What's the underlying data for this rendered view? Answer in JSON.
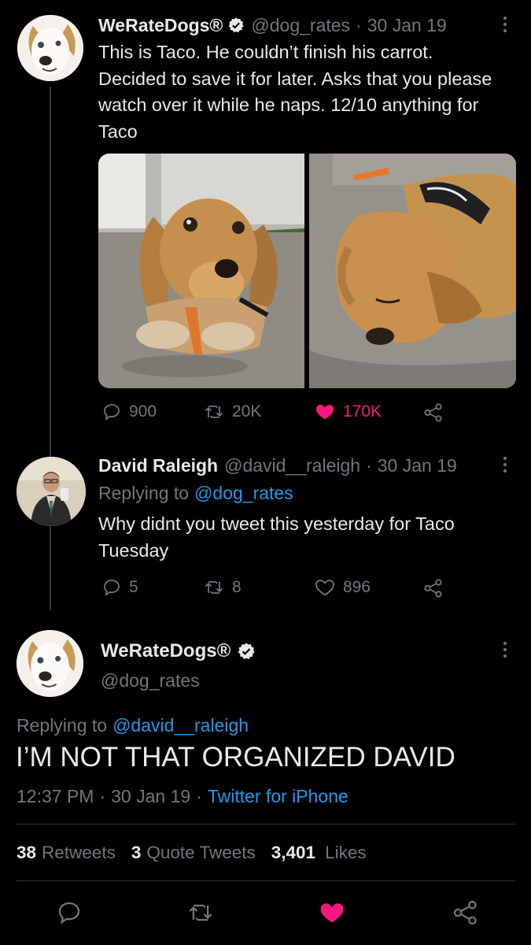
{
  "tweet1": {
    "name": "WeRateDogs®",
    "handle": "@dog_rates",
    "sep": "·",
    "date": "30 Jan 19",
    "text": "This is Taco. He couldn’t finish his carrot. Decided to save it for later. Asks that you please watch over it while he naps. 12/10 anything for Taco",
    "replies": "900",
    "retweets": "20K",
    "likes": "170K",
    "liked_color": "#f91880"
  },
  "tweet2": {
    "name": "David Raleigh",
    "handle": "@david__raleigh",
    "sep": "·",
    "date": "30 Jan 19",
    "replying_prefix": "Replying to",
    "replying_handle": "@dog_rates",
    "text": "Why didnt you tweet this yesterday for Taco Tuesday",
    "replies": "5",
    "retweets": "8",
    "likes": "896"
  },
  "main": {
    "name": "WeRateDogs®",
    "handle": "@dog_rates",
    "replying_prefix": "Replying to",
    "replying_handle": "@david__raleigh",
    "text": "I’M NOT THAT ORGANIZED DAVID",
    "time": "12:37 PM",
    "sep": "·",
    "date": "30 Jan 19",
    "sep2": "·",
    "source": "Twitter for iPhone",
    "stats": {
      "retweets_count": "38",
      "retweets_label": "Retweets",
      "quotes_count": "3",
      "quotes_label": "Quote Tweets",
      "likes_count": "3,401",
      "likes_label": "Likes"
    }
  },
  "colors": {
    "accent": "#1d9bf0",
    "like": "#f91880",
    "muted": "#71767b",
    "text": "#e7e9ea"
  }
}
